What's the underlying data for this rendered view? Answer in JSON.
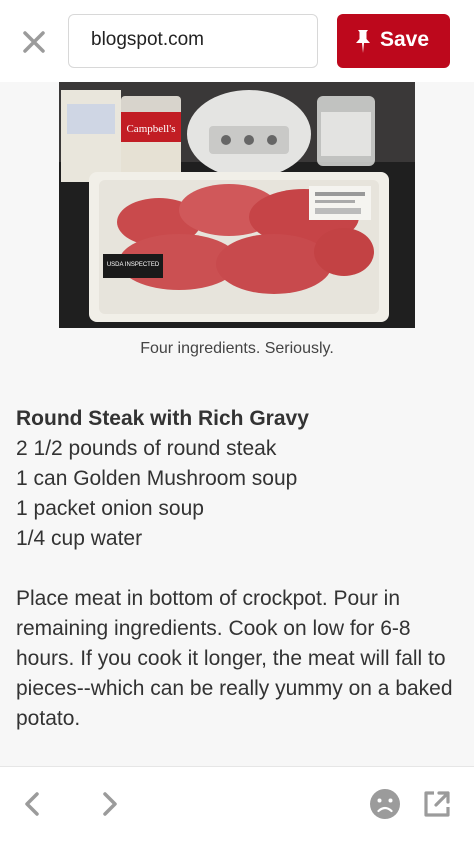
{
  "toolbar": {
    "url": "blogspot.com",
    "save_label": "Save"
  },
  "post": {
    "image_caption": "Four ingredients. Seriously.",
    "recipe_title": "Round Steak with Rich Gravy",
    "ingredients": [
      "2 1/2 pounds of round steak",
      "1 can Golden Mushroom soup",
      "1 packet onion soup",
      "1/4 cup water"
    ],
    "instructions": "Place meat in bottom of crockpot. Pour in remaining ingredients. Cook on low for 6-8 hours. If you cook it longer, the meat will fall to pieces--which can be really yummy on a baked potato."
  },
  "photo": {
    "can_label": "Campbell's",
    "package_label": "USDA INSPECTED"
  },
  "icons": {
    "close": "close-icon",
    "pin": "pin-icon",
    "back": "chevron-left-icon",
    "forward": "chevron-right-icon",
    "report": "sad-face-icon",
    "open_external": "external-link-icon"
  },
  "colors": {
    "save_red": "#bd081c",
    "icon_gray": "#9b9b9b",
    "content_bg": "#f7f7f7"
  }
}
